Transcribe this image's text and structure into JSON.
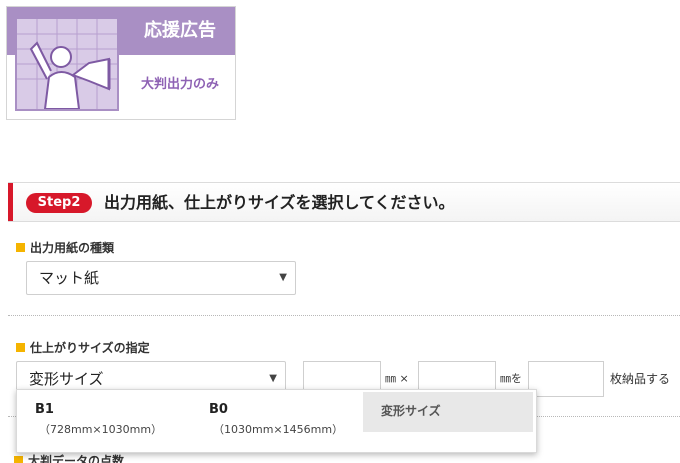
{
  "category": {
    "title": "応援広告",
    "subtitle": "大判出力のみ"
  },
  "step": {
    "badge": "Step2",
    "heading": "出力用紙、仕上がりサイズを選択してください。"
  },
  "paper": {
    "label": "出力用紙の種類",
    "value": "マット紙"
  },
  "size": {
    "label": "仕上がりサイズの指定",
    "value": "変形サイズ",
    "unit_mm": "㎜",
    "times": "×",
    "unit_mm_wo": "㎜を",
    "count_suffix": "枚納品する",
    "options": [
      {
        "name": "B1",
        "dims": "（728mm×1030mm）"
      },
      {
        "name": "B0",
        "dims": "（1030mm×1456mm）"
      },
      {
        "name": "変形サイズ",
        "dims": ""
      }
    ]
  },
  "next_section": {
    "label": "大判データの点数"
  },
  "colors": {
    "accent_purple": "#a98fc4",
    "step_red": "#d7182a",
    "bullet_yellow": "#f5b400"
  }
}
